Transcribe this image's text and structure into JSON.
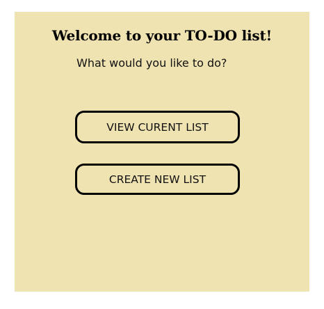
{
  "header": {
    "title": "Welcome to your TO-DO list!",
    "prompt": "What would you like to do?"
  },
  "actions": {
    "view_label": "VIEW CURENT LIST",
    "create_label": "CREATE NEW LIST"
  },
  "colors": {
    "panel_background": "#f0e3b2",
    "button_border": "#000000"
  }
}
